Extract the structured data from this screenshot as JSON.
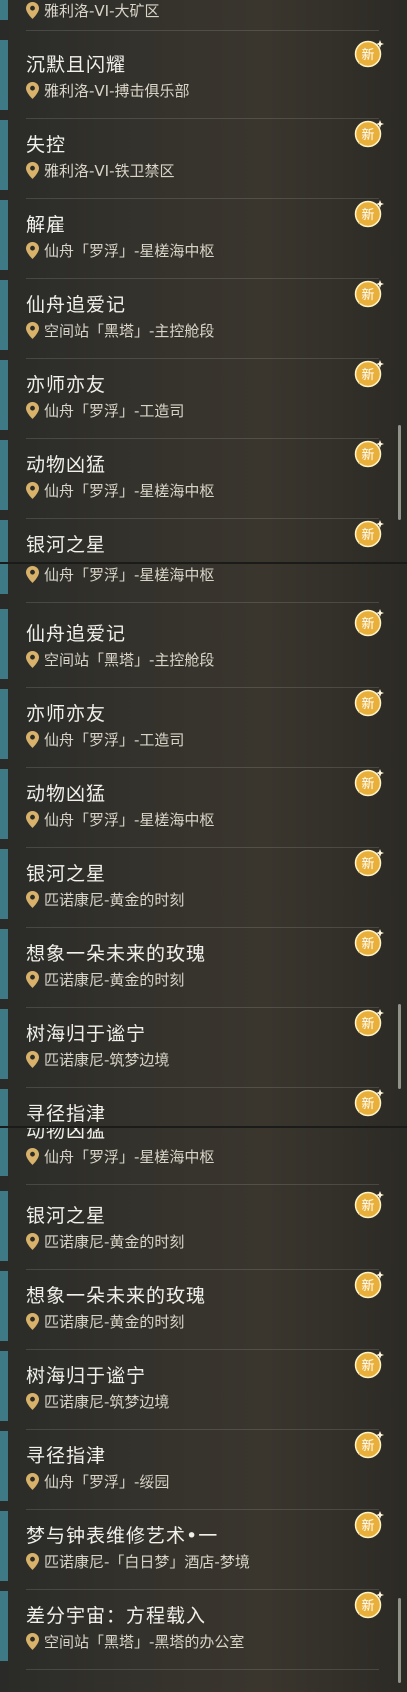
{
  "badge_text": "新",
  "panel1": {
    "items": [
      {
        "title": "",
        "location": "雅利洛-VI-大矿区"
      },
      {
        "title": "沉默且闪耀",
        "location": "雅利洛-VI-搏击俱乐部"
      },
      {
        "title": "失控",
        "location": "雅利洛-VI-铁卫禁区"
      },
      {
        "title": "解雇",
        "location": "仙舟「罗浮」-星槎海中枢"
      },
      {
        "title": "仙舟追爱记",
        "location": "空间站「黑塔」-主控舱段"
      },
      {
        "title": "亦师亦友",
        "location": "仙舟「罗浮」-工造司"
      },
      {
        "title": "动物凶猛",
        "location": "仙舟「罗浮」-星槎海中枢"
      },
      {
        "title": "银河之星",
        "location": ""
      }
    ]
  },
  "panel2": {
    "items": [
      {
        "title": "",
        "location": "仙舟「罗浮」-星槎海中枢"
      },
      {
        "title": "仙舟追爱记",
        "location": "空间站「黑塔」-主控舱段"
      },
      {
        "title": "亦师亦友",
        "location": "仙舟「罗浮」-工造司"
      },
      {
        "title": "动物凶猛",
        "location": "仙舟「罗浮」-星槎海中枢"
      },
      {
        "title": "银河之星",
        "location": "匹诺康尼-黄金的时刻"
      },
      {
        "title": "想象一朵未来的玫瑰",
        "location": "匹诺康尼-黄金的时刻"
      },
      {
        "title": "树海归于谧宁",
        "location": "匹诺康尼-筑梦边境"
      },
      {
        "title": "寻径指津",
        "location": ""
      }
    ]
  },
  "panel3": {
    "items": [
      {
        "title": "动物凶猛",
        "location": "仙舟「罗浮」-星槎海中枢"
      },
      {
        "title": "银河之星",
        "location": "匹诺康尼-黄金的时刻"
      },
      {
        "title": "想象一朵未来的玫瑰",
        "location": "匹诺康尼-黄金的时刻"
      },
      {
        "title": "树海归于谧宁",
        "location": "匹诺康尼-筑梦边境"
      },
      {
        "title": "寻径指津",
        "location": "仙舟「罗浮」-绥园"
      },
      {
        "title": "梦与钟表维修艺术•一",
        "location": "匹诺康尼-「白日梦」酒店-梦境"
      },
      {
        "title": "差分宇宙：方程载入",
        "location": "空间站「黑塔」-黑塔的办公室"
      }
    ]
  },
  "colors": {
    "accent": "#3d7a86",
    "badge": "#e0a52c",
    "pin": "#d8b26a"
  }
}
